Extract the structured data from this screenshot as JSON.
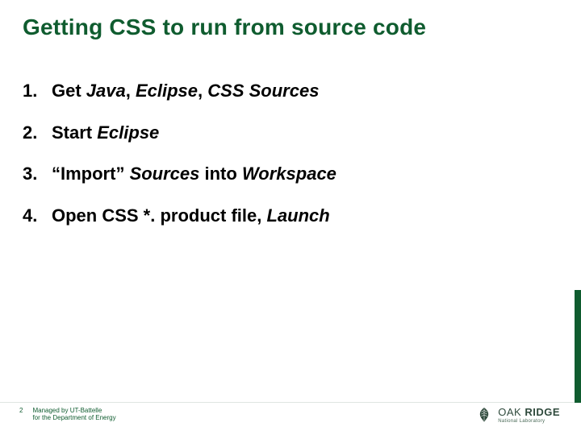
{
  "title": "Getting CSS to run from source code",
  "steps": [
    {
      "pre": "Get ",
      "em1": "Java",
      "mid1": ", ",
      "em2": "Eclipse",
      "mid2": ", ",
      "em3": "CSS Sources",
      "post": ""
    },
    {
      "pre": "Start ",
      "em1": "Eclipse",
      "mid1": "",
      "em2": "",
      "mid2": "",
      "em3": "",
      "post": ""
    },
    {
      "pre": "“Import” ",
      "em1": "Sources",
      "mid1": " into ",
      "em2": "Workspace",
      "mid2": "",
      "em3": "",
      "post": ""
    },
    {
      "pre": "Open CSS *. product file, ",
      "em1": "Launch",
      "mid1": "",
      "em2": "",
      "mid2": "",
      "em3": "",
      "post": ""
    }
  ],
  "footer": {
    "page": "2",
    "line1": "Managed by UT-Battelle",
    "line2": "for the Department of Energy"
  },
  "logo": {
    "top_plain": "OAK",
    "top_bold": "RIDGE",
    "sub": "National Laboratory"
  }
}
